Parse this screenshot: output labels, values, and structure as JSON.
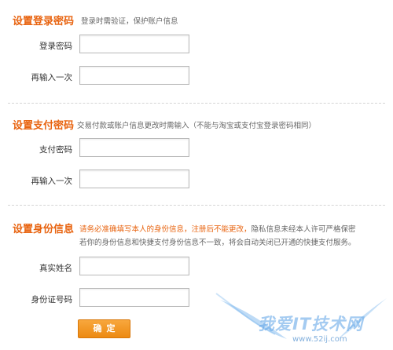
{
  "login_section": {
    "title": "设置登录密码",
    "desc": "登录时需验证，保护账户信息",
    "password_label": "登录密码",
    "confirm_label": "再输入一次"
  },
  "pay_section": {
    "title": "设置支付密码",
    "desc": "交易付款或账户信息更改时需输入（不能与淘宝或支付宝登录密码相同）",
    "password_label": "支付密码",
    "confirm_label": "再输入一次"
  },
  "identity_section": {
    "title": "设置身份信息",
    "warning": "请务必准确填写本人的身份信息，注册后不能更改，",
    "note_line1": "隐私信息未经本人许可严格保密",
    "note_line2": "若你的身份信息和快捷支付身份信息不一致，将会自动关闭已开通的快捷支付服务。",
    "name_label": "真实姓名",
    "id_label": "身份证号码"
  },
  "submit": {
    "label": "确定"
  },
  "watermark": {
    "text": "我爱IT技术网",
    "url": "www.52ij.com"
  },
  "colors": {
    "accent": "#e8630f",
    "button": "#f19a28"
  }
}
